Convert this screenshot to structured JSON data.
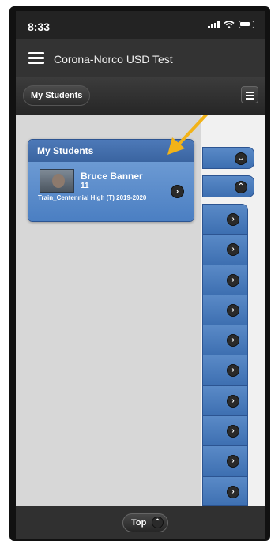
{
  "status_bar": {
    "time": "8:33"
  },
  "app_header": {
    "title": "Corona-Norco USD Test"
  },
  "toolbar": {
    "my_students_label": "My Students"
  },
  "card": {
    "title": "My Students",
    "student": {
      "name": "Bruce Banner",
      "grade": "11",
      "school": "Train_Centennial High (T) 2019-2020"
    }
  },
  "bottom_bar": {
    "top_label": "Top"
  },
  "colors": {
    "accent_blue": "#4a7ec2",
    "arrow": "#f2b318"
  }
}
